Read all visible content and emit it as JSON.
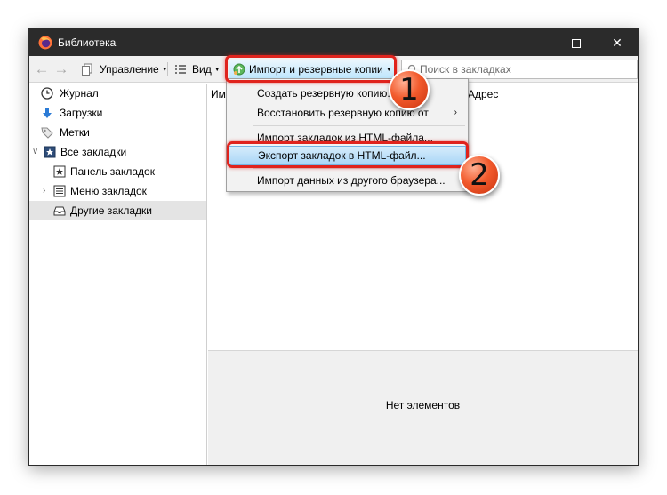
{
  "window": {
    "title": "Библиотека",
    "minimize": "",
    "maximize": "",
    "close": "✕"
  },
  "toolbar": {
    "back_icon": "arrow-left-icon",
    "forward_icon": "arrow-right-icon",
    "manage_label": "Управление",
    "view_label": "Вид",
    "import_label": "Импорт и резервные копии",
    "search_placeholder": "Поиск в закладках"
  },
  "sidebar": {
    "items": [
      {
        "label": "Журнал",
        "icon": "clock-icon"
      },
      {
        "label": "Загрузки",
        "icon": "download-arrow-icon"
      },
      {
        "label": "Метки",
        "icon": "tag-icon"
      },
      {
        "label": "Все закладки",
        "icon": "star-folder-icon"
      },
      {
        "label": "Панель закладок",
        "icon": "star-folder-icon"
      },
      {
        "label": "Меню закладок",
        "icon": "menu-list-icon"
      },
      {
        "label": "Другие закладки",
        "icon": "inbox-icon"
      }
    ]
  },
  "content": {
    "columns": [
      "Им",
      "Адрес"
    ],
    "empty_text": "Нет элементов"
  },
  "import_menu": {
    "items": [
      {
        "label": "Создать резервную копию..."
      },
      {
        "label": "Восстановить резервную копию от"
      },
      {
        "label": "Импорт закладок из HTML-файла..."
      },
      {
        "label": "Экспорт закладок в HTML-файл..."
      },
      {
        "label": "Импорт данных из другого браузера..."
      }
    ]
  },
  "annotations": {
    "step1": "1",
    "step2": "2",
    "highlight_color": "#e0231d",
    "badge_color": "#f25a2c"
  },
  "colors": {
    "titlebar": "#2b2b2b",
    "menu_highlight": "#a9d6f7",
    "selected_row": "#e4e4e4"
  }
}
